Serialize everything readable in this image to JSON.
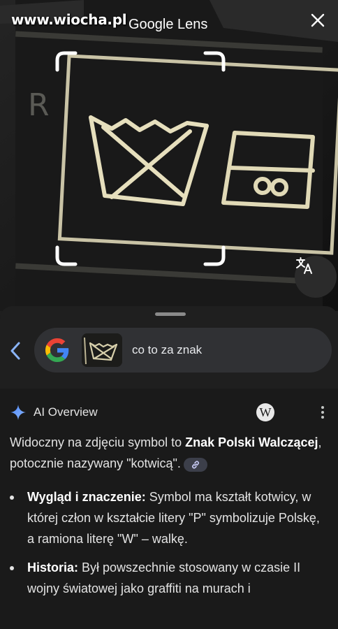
{
  "watermark": "www.wiocha.pl",
  "header": {
    "title": "Google Lens"
  },
  "icons": {
    "close": "close-icon",
    "translate": "translate-icon",
    "back": "chevron-left-icon",
    "google": "google-g-icon",
    "sparkle": "ai-sparkle-icon",
    "wikipedia": "wikipedia-icon",
    "more": "more-vert-icon",
    "link": "link-icon"
  },
  "photo": {
    "tag_letter": "R"
  },
  "search": {
    "query": "co to za znak"
  },
  "ai_overview": {
    "title": "AI Overview",
    "wiki_glyph": "W",
    "intro": {
      "pre": "Widoczny na zdjęciu symbol to ",
      "bold": "Znak Polski Walczącej",
      "post": ", potocznie nazywany \"kotwicą\"."
    },
    "bullets": [
      {
        "bold": "Wygląd i znaczenie:",
        "text": " Symbol ma kształt kotwicy, w której człon w kształcie litery \"P\" symbolizuje Polskę, a ramiona literę \"W\" – walkę."
      },
      {
        "bold": "Historia:",
        "text": " Był powszechnie stosowany w czasie II wojny światowej jako graffiti na murach i"
      }
    ]
  },
  "colors": {
    "google_blue": "#4285F4",
    "google_red": "#EA4335",
    "google_yellow": "#FBBC05",
    "google_green": "#34A853",
    "back_arrow": "#8ab4f8",
    "sheet_bg": "#1f1f1f",
    "search_bg": "#303134"
  }
}
